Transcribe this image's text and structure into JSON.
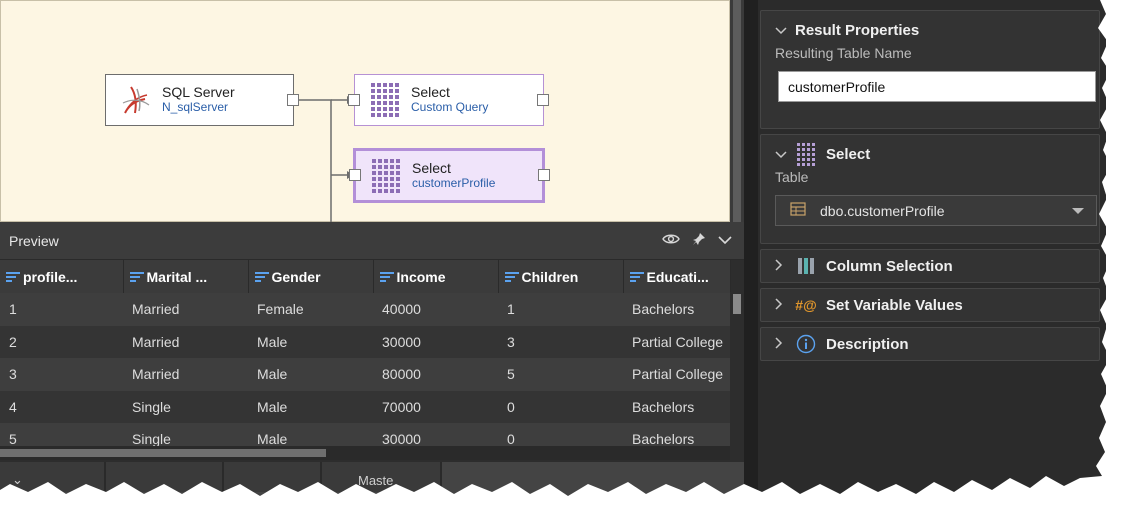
{
  "canvas": {
    "nodes": [
      {
        "title": "SQL Server",
        "subtitle": "N_sqlServer",
        "icon": "sql-server-icon"
      },
      {
        "title": "Select",
        "subtitle": "Custom Query",
        "icon": "table-grid-icon"
      },
      {
        "title": "Select",
        "subtitle": "customerProfile",
        "icon": "table-grid-icon"
      }
    ]
  },
  "preview": {
    "title": "Preview",
    "icons": [
      "eye-icon",
      "pin-icon",
      "chevron-down-icon"
    ],
    "columns": [
      "profile...",
      "Marital ...",
      "Gender",
      "Income",
      "Children",
      "Educati..."
    ],
    "rows": [
      [
        "1",
        "Married",
        "Female",
        "40000",
        "1",
        "Bachelors"
      ],
      [
        "2",
        "Married",
        "Male",
        "30000",
        "3",
        "Partial College"
      ],
      [
        "3",
        "Married",
        "Male",
        "80000",
        "5",
        "Partial College"
      ],
      [
        "4",
        "Single",
        "Male",
        "70000",
        "0",
        "Bachelors"
      ],
      [
        "5",
        "Single",
        "Male",
        "30000",
        "0",
        "Bachelors"
      ]
    ]
  },
  "bottom_tabs": [
    "",
    "",
    "",
    "Maste"
  ],
  "properties": {
    "result": {
      "title": "Result Properties",
      "name_label": "Resulting Table Name",
      "name_value": "customerProfile"
    },
    "select": {
      "title": "Select",
      "table_label": "Table",
      "table_value": "dbo.customerProfile"
    },
    "column_selection": {
      "title": "Column Selection"
    },
    "set_variable_values": {
      "title": "Set Variable Values"
    },
    "description": {
      "title": "Description"
    }
  },
  "colors": {
    "canvas_bg": "#fdf6e3",
    "node_accent": "#b38fd8",
    "link_blue": "#2a5ea8",
    "header_icon_blue": "#5ba2ef",
    "panel_bg": "#2b2b2b"
  }
}
